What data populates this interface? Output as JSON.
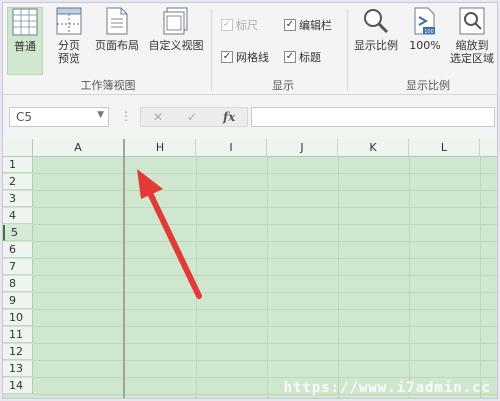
{
  "ribbon": {
    "workbook_views": {
      "normal_label": "普通",
      "page_break_label_1": "分页",
      "page_break_label_2": "预览",
      "page_layout_label": "页面布局",
      "custom_view_label": "自定义视图",
      "group_label": "工作簿视图"
    },
    "show": {
      "ruler_label": "标尺",
      "formula_bar_label": "编辑栏",
      "gridlines_label": "网格线",
      "headings_label": "标题",
      "group_label": "显示"
    },
    "zoom": {
      "zoom_label": "显示比例",
      "zoom100_label": "100%",
      "zoom_selection_label_1": "缩放到",
      "zoom_selection_label_2": "选定区域",
      "group_label": "显示比例"
    }
  },
  "formula_bar": {
    "name_box": "C5",
    "cancel_glyph": "✕",
    "enter_glyph": "✓",
    "fx_glyph": "fx",
    "formula": ""
  },
  "sheet": {
    "columns": [
      "A",
      "H",
      "I",
      "J",
      "K",
      "L"
    ],
    "rows": [
      "1",
      "2",
      "3",
      "4",
      "5",
      "6",
      "7",
      "8",
      "9",
      "10",
      "11",
      "12",
      "13",
      "14"
    ],
    "selected_row": "5"
  },
  "annotation": {
    "arrow_color": "#e53935"
  },
  "watermark": "https://www.i7admin.cc",
  "colors": {
    "sheet_bg": "#cfe6cf",
    "active_button": "#cfe6cf"
  }
}
